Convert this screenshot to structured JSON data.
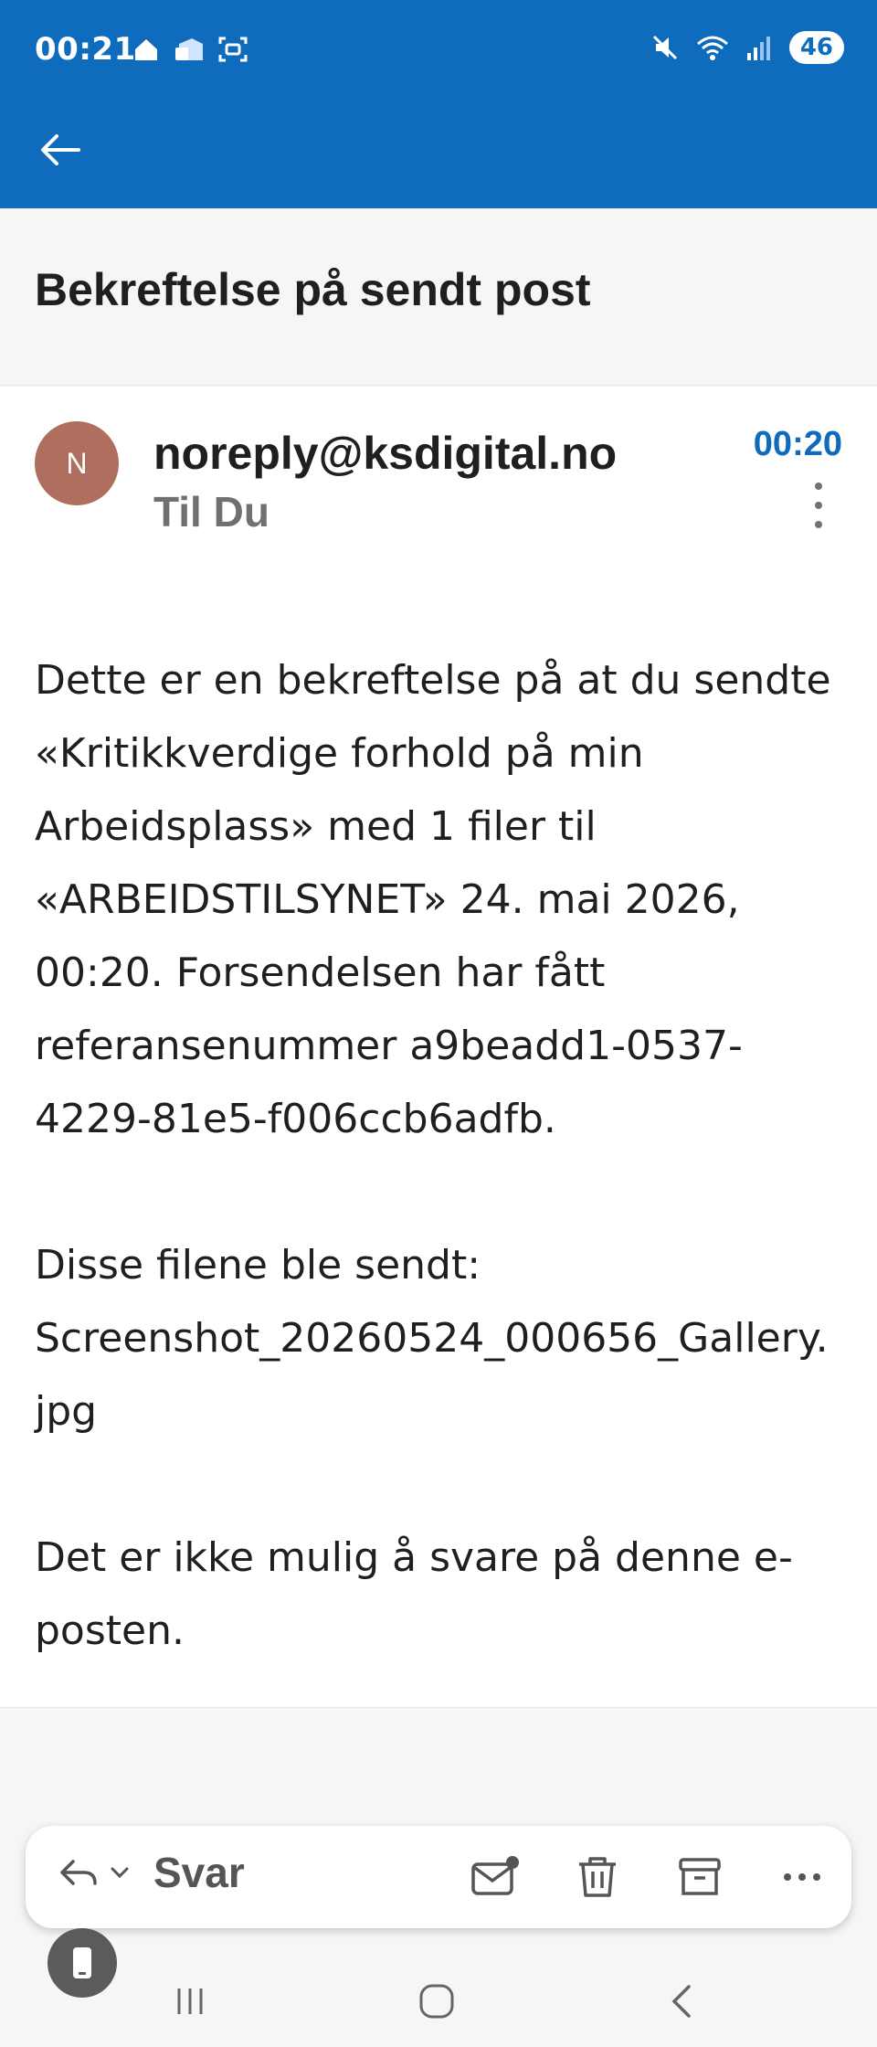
{
  "status_bar": {
    "time": "00:21",
    "battery": "46"
  },
  "header": {
    "subject": "Bekreftelse på sendt post"
  },
  "message": {
    "avatar_letter": "N",
    "sender": "noreply@ksdigital.no",
    "recipient": "Til Du",
    "time": "00:20",
    "paragraphs": [
      "Dette er en bekreftelse på at du sendte «Kritikkverdige forhold på min Arbeidsplass» med 1 filer til «ARBEIDSTILSYNET» 24. mai 2026, 00:20. Forsendelsen har fått referansenummer a9beadd1-0537-4229-81e5-f006ccb6adfb.",
      "Disse filene ble sendt:",
      "Screenshot_20260524_000656_Gallery.jpg",
      "Det er ikke mulig å svare på denne e-posten."
    ]
  },
  "action_bar": {
    "reply_label": "Svar",
    "icons": [
      "reply-icon",
      "chevron-down-icon",
      "mark-unread-icon",
      "delete-icon",
      "archive-icon",
      "more-horizontal-icon"
    ]
  },
  "colors": {
    "accent": "#0f6cbd",
    "avatar": "#b06f5e"
  }
}
